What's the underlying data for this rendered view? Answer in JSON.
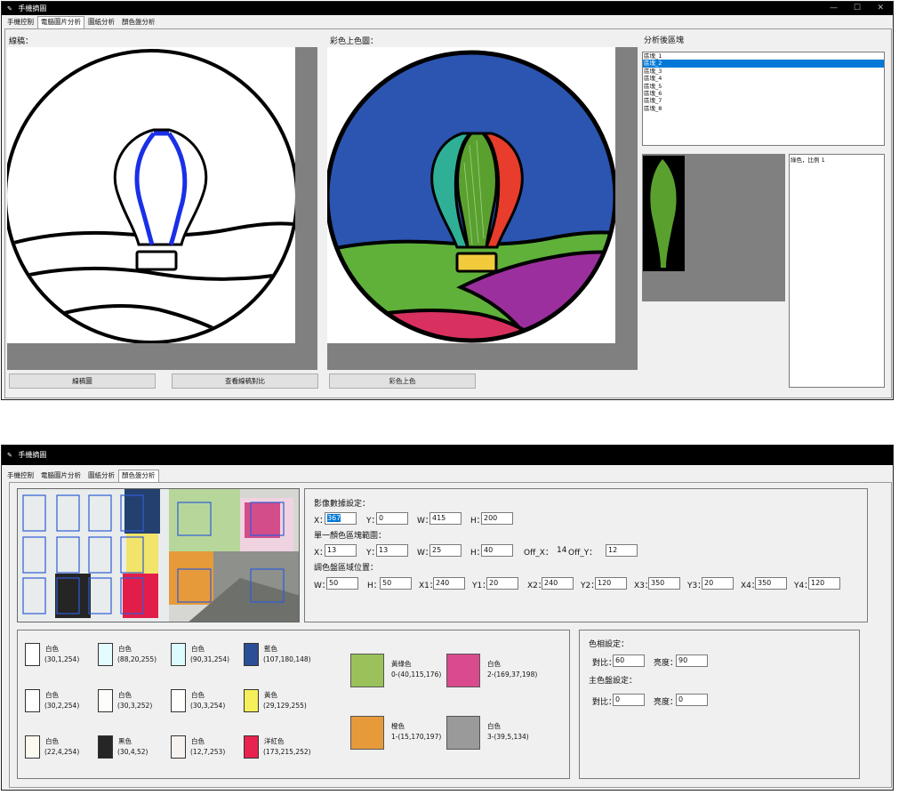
{
  "window1": {
    "title": "手機摘圖",
    "tabs": [
      "手機控制",
      "電腦圖片分析",
      "圖紙分析",
      "顏色盤分析"
    ],
    "active_tab": 1,
    "line_label": "線稿：",
    "color_label": "彩色上色圖：",
    "analysis_label": "分析後區塊",
    "regions": [
      "區塊_1",
      "區塊_2",
      "區塊_3",
      "區塊_4",
      "區塊_5",
      "區塊_6",
      "區塊_7",
      "區塊_8"
    ],
    "selected_region": 1,
    "color_info": "綠色，比例 1",
    "btn_line": "線稿圖",
    "btn_check": "查看線稿對比",
    "btn_color": "彩色上色"
  },
  "window2": {
    "title": "手機摘圖",
    "tabs": [
      "手機控制",
      "電腦圖片分析",
      "圖紙分析",
      "顏色盤分析"
    ],
    "active_tab": 3,
    "img_section_label": "影像數據設定：",
    "x_label": "X：",
    "x_value": "367",
    "y_label": "Y：",
    "y_value": "0",
    "w_label": "W：",
    "w_value": "415",
    "h_label": "H：",
    "h_value": "200",
    "block_section_label": "單一顏色區塊範圍：",
    "bx_label": "X：",
    "bx_value": "13",
    "by_label": "Y：",
    "by_value": "13",
    "bw_label": "W：",
    "bw_value": "25",
    "bh_label": "H：",
    "bh_value": "40",
    "offx_label": "Off_X：",
    "offx_value": "14",
    "offy_label": "Off_Y：",
    "offy_value": "12",
    "palette_section_label": "調色盤區域位置：",
    "pw_label": "W：",
    "pw_value": "50",
    "ph_label": "H：",
    "ph_value": "50",
    "x1_label": "X1：",
    "x1_value": "240",
    "y1_label": "Y1：",
    "y1_value": "20",
    "x2_label": "X2：",
    "x2_value": "240",
    "y2_label": "Y2：",
    "y2_value": "120",
    "x3_label": "X3：",
    "x3_value": "350",
    "y3_label": "Y3：",
    "y3_value": "20",
    "x4_label": "X4：",
    "x4_value": "350",
    "y4_label": "Y4：",
    "y4_value": "120",
    "swatches": [
      {
        "name": "白色",
        "hsv": "(30,1,254)",
        "color": "#ffffff"
      },
      {
        "name": "白色",
        "hsv": "(88,20,255)",
        "color": "#e4fbff"
      },
      {
        "name": "白色",
        "hsv": "(90,31,254)",
        "color": "#dcfbff"
      },
      {
        "name": "藍色",
        "hsv": "(107,180,148)",
        "color": "#2a4f96"
      },
      {
        "name": "白色",
        "hsv": "(30,2,254)",
        "color": "#ffffff"
      },
      {
        "name": "白色",
        "hsv": "(30,3,252)",
        "color": "#fdfdfc"
      },
      {
        "name": "白色",
        "hsv": "(30,3,254)",
        "color": "#fefefd"
      },
      {
        "name": "黃色",
        "hsv": "(29,129,255)",
        "color": "#f5f05a"
      },
      {
        "name": "白色",
        "hsv": "(22,4,254)",
        "color": "#fbf9f0"
      },
      {
        "name": "黑色",
        "hsv": "(30,4,52)",
        "color": "#262626"
      },
      {
        "name": "白色",
        "hsv": "(12,7,253)",
        "color": "#f5f2ef"
      },
      {
        "name": "洋紅色",
        "hsv": "(173,215,252)",
        "color": "#e8234f"
      }
    ],
    "palette_results": [
      {
        "name": "黃綠色",
        "hsv": "0-(40,115,176)",
        "color": "#9bc25a"
      },
      {
        "name": "白色",
        "hsv": "2-(169,37,198)",
        "color": "#d94a8e"
      },
      {
        "name": "橙色",
        "hsv": "1-(15,170,197)",
        "color": "#e69a3a"
      },
      {
        "name": "白色",
        "hsv": "3-(39,5,134)",
        "color": "#9a9a9a"
      }
    ],
    "color_set_label": "色相設定：",
    "contrast_label": "對比：",
    "contrast_value": "60",
    "bright_label": "亮度：",
    "bright_value": "90",
    "main_set_label": "主色盤設定：",
    "contrast2_label": "對比：",
    "contrast2_value": "0",
    "bright2_label": "亮度：",
    "bright2_value": "0"
  }
}
